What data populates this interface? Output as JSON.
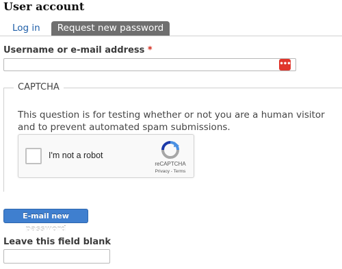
{
  "page": {
    "title": "User account"
  },
  "tabs": [
    {
      "label": "Log in",
      "active": false
    },
    {
      "label": "Request new password",
      "active": true
    }
  ],
  "form": {
    "username_label": "Username or e-mail address",
    "required_marker": "*",
    "username_value": "",
    "password_manager_icon": "lastpass-dots-icon",
    "password_manager_glyph": "•••",
    "captcha": {
      "legend": "CAPTCHA",
      "description": "This question is for testing whether or not you are a human visitor and to prevent automated spam submissions.",
      "recaptcha_label": "I'm not a robot",
      "recaptcha_brand": "reCAPTCHA",
      "recaptcha_links": "Privacy - Terms",
      "checked": false
    },
    "submit_label": "E-mail new password",
    "honeypot_label": "Leave this field blank",
    "honeypot_value": ""
  },
  "colors": {
    "link": "#1f5fa8",
    "active_tab_bg": "#6f6f6f",
    "required": "#d32a1c",
    "button_bg": "#3f7fcf",
    "password_icon_bg": "#e0362c"
  }
}
